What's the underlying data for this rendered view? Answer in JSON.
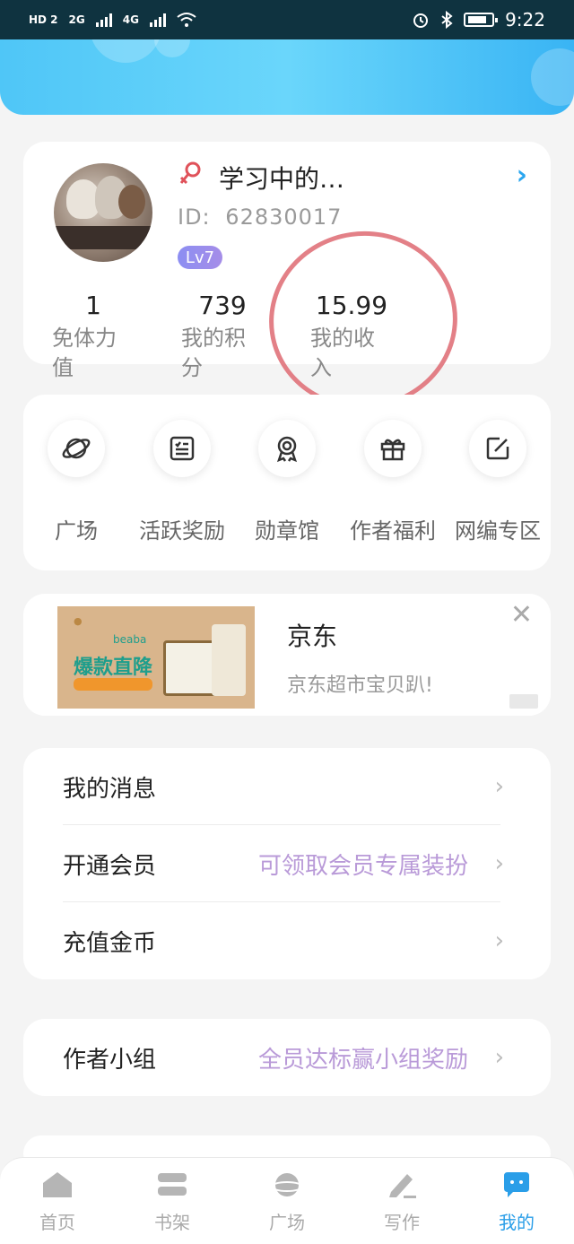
{
  "status_bar": {
    "left_text": "HD 2",
    "net1": "2G",
    "net2": "4G",
    "time": "9:22"
  },
  "profile": {
    "username": "学习中的…",
    "id_label": "ID:",
    "id_value": "62830017",
    "level": "Lv7",
    "stats": [
      {
        "value": "1",
        "label_line1": "免体力",
        "label_line2": "值"
      },
      {
        "value": "739",
        "label_line1": "我的积",
        "label_line2": "分"
      },
      {
        "value": "15.99",
        "label_line1": "我的收",
        "label_line2": "入"
      }
    ]
  },
  "quick_menu": [
    {
      "label": "广场",
      "icon": "planet-icon"
    },
    {
      "label": "活跃奖励",
      "icon": "checklist-icon"
    },
    {
      "label": "勋章馆",
      "icon": "medal-icon"
    },
    {
      "label": "作者福利",
      "icon": "gift-icon"
    },
    {
      "label": "网编专区",
      "icon": "edit-icon"
    }
  ],
  "ad": {
    "title": "京东",
    "subtitle": "京东超市宝贝趴!",
    "image_brand": "beaba",
    "image_headline": "爆款直降"
  },
  "settings_list": [
    {
      "label": "我的消息",
      "value": ""
    },
    {
      "label": "开通会员",
      "value": "可领取会员专属装扮"
    },
    {
      "label": "充值金币",
      "value": ""
    }
  ],
  "group_row": {
    "label": "作者小组",
    "value": "全员达标赢小组奖励"
  },
  "tabbar": {
    "tabs": [
      {
        "label": "首页",
        "icon": "home-icon"
      },
      {
        "label": "书架",
        "icon": "bookshelf-icon"
      },
      {
        "label": "广场",
        "icon": "planet-icon"
      },
      {
        "label": "写作",
        "icon": "pen-icon"
      },
      {
        "label": "我的",
        "icon": "chat-bubble-icon"
      }
    ],
    "active_index": 4,
    "active_color": "#2a9ee8"
  },
  "colors": {
    "header_gradient_start": "#4fc6f7",
    "accent_blue": "#2aa6ef",
    "value_purple": "#b99ad8",
    "annotation_red": "#e0727a"
  }
}
